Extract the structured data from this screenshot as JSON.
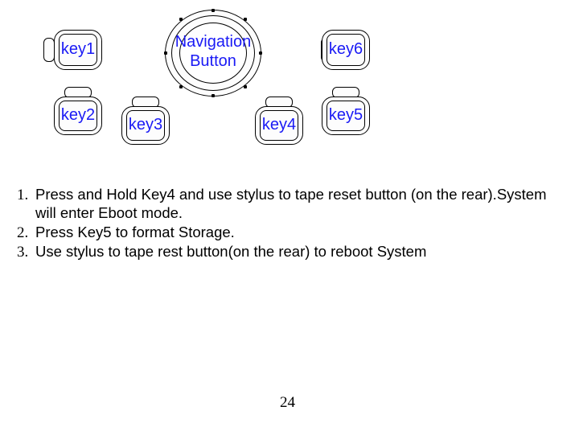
{
  "diagram": {
    "nav_label_line1": "Navigation",
    "nav_label_line2": "Button",
    "key1": "key1",
    "key2": "key2",
    "key3": "key3",
    "key4": "key4",
    "key5": "key5",
    "key6": "key6"
  },
  "instructions": {
    "item1": "Press and Hold Key4 and use stylus to tape reset button (on the rear).System will enter Eboot mode.",
    "item2": "Press Key5 to format Storage.",
    "item3": "Use stylus to tape rest button(on the rear) to reboot System"
  },
  "page_number": "24"
}
